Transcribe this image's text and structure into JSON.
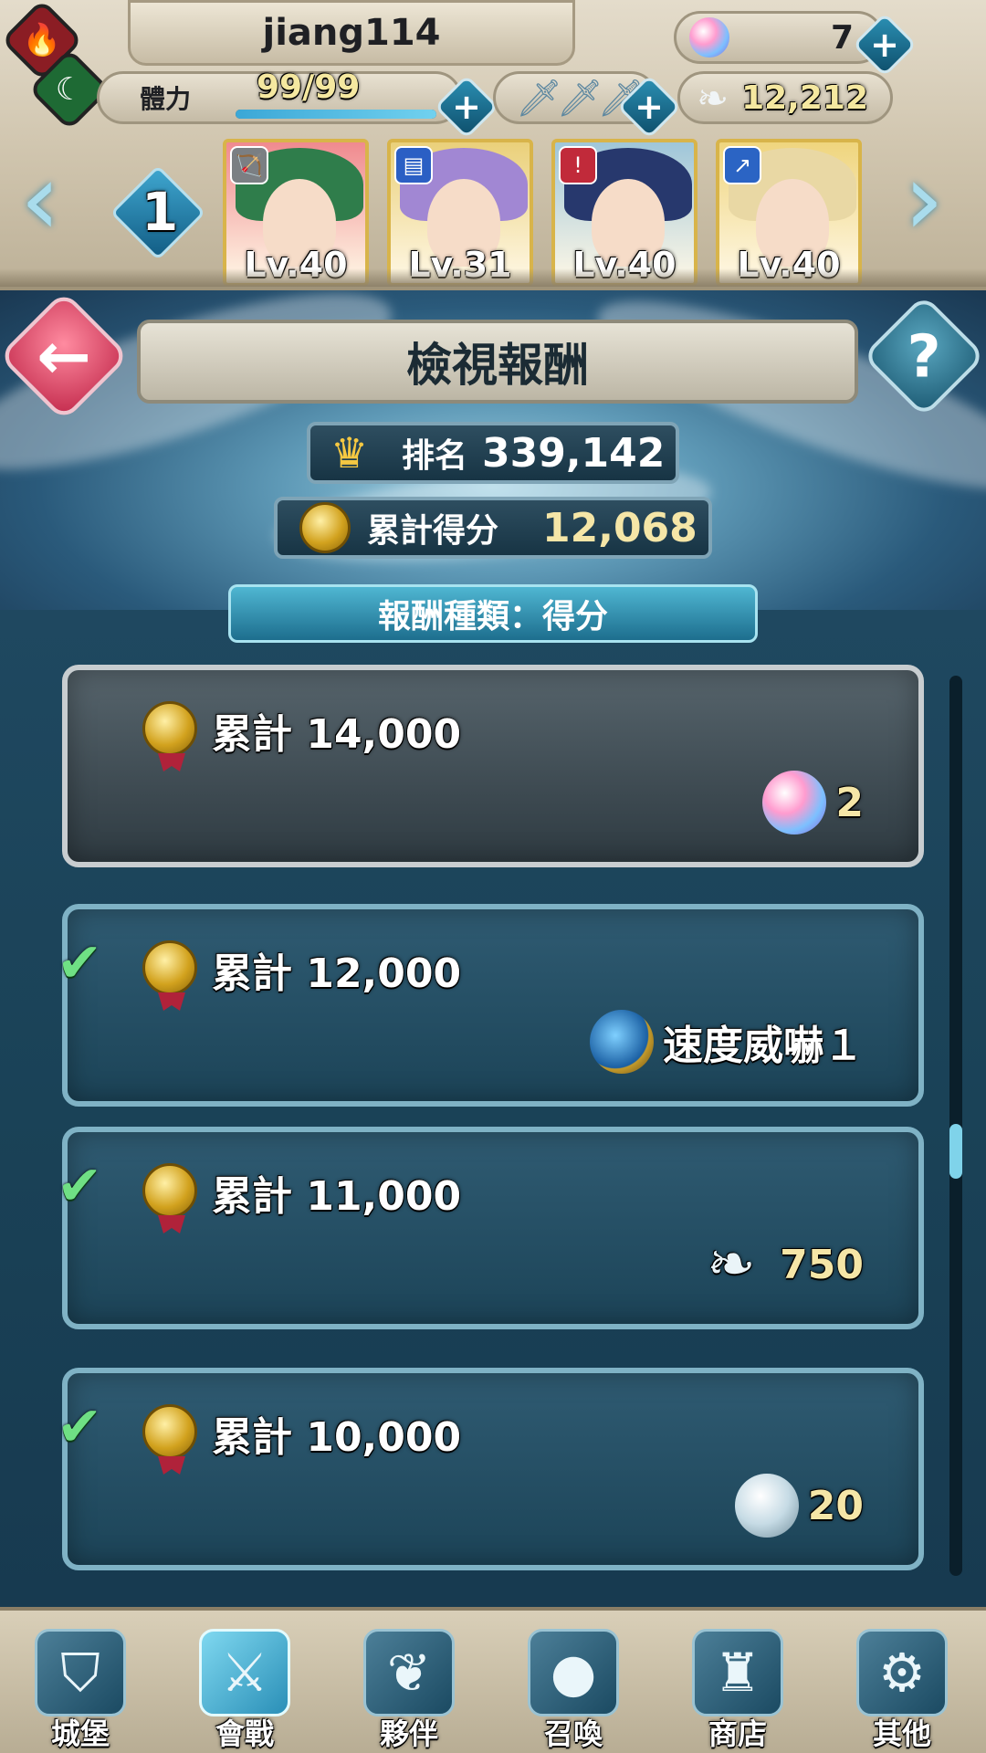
{
  "header": {
    "username": "jiang114",
    "orbs": "7",
    "stamina_label": "體力",
    "stamina_value": "99/99",
    "stamina_fraction": 1.0,
    "feathers": "12,212",
    "team_number": "1",
    "heroes": [
      {
        "level": "Lv.40",
        "weapon_icon": "bow-icon",
        "bg": "#f08a8f",
        "hair": "#2f7d4b"
      },
      {
        "level": "Lv.31",
        "weapon_icon": "tome-icon",
        "bg": "#ead07a",
        "hair": "#a187d3"
      },
      {
        "level": "Lv.40",
        "weapon_icon": "sword-icon",
        "bg": "#9fc6d9",
        "hair": "#27386d"
      },
      {
        "level": "Lv.40",
        "weapon_icon": "lance-icon",
        "bg": "#efd57e",
        "hair": "#e9d8a4"
      }
    ]
  },
  "page": {
    "title": "檢視報酬",
    "rank_label": "排名",
    "rank_value": "339,142",
    "score_label": "累計得分",
    "score_value": "12,068",
    "reward_type": "報酬種類：得分"
  },
  "rewards": [
    {
      "label": "累計",
      "threshold": "14,000",
      "reward_icon": "orb-icon",
      "reward_text": "2",
      "claimed": false
    },
    {
      "label": "累計",
      "threshold": "12,000",
      "reward_icon": "skill-scroll-icon",
      "reward_text": "速度威嚇１",
      "claimed": true
    },
    {
      "label": "累計",
      "threshold": "11,000",
      "reward_icon": "feather-icon",
      "reward_text": "750",
      "claimed": true
    },
    {
      "label": "累計",
      "threshold": "10,000",
      "reward_icon": "badge-icon",
      "reward_text": "20",
      "claimed": true
    }
  ],
  "scroll_position": 0.53,
  "nav": [
    {
      "label": "城堡",
      "icon": "castle-crest-icon",
      "glyph": "⛉"
    },
    {
      "label": "會戰",
      "icon": "crossed-swords-icon",
      "glyph": "⚔"
    },
    {
      "label": "夥伴",
      "icon": "wing-icon",
      "glyph": "❦"
    },
    {
      "label": "召喚",
      "icon": "orb-icon",
      "glyph": "●"
    },
    {
      "label": "商店",
      "icon": "shop-castle-icon",
      "glyph": "♜"
    },
    {
      "label": "其他",
      "icon": "gear-icon",
      "glyph": "⚙"
    }
  ],
  "colors": {
    "accent": "#2a8fb7",
    "claimed_check": "#6fe084",
    "reward_number": "#f5e6a7"
  }
}
